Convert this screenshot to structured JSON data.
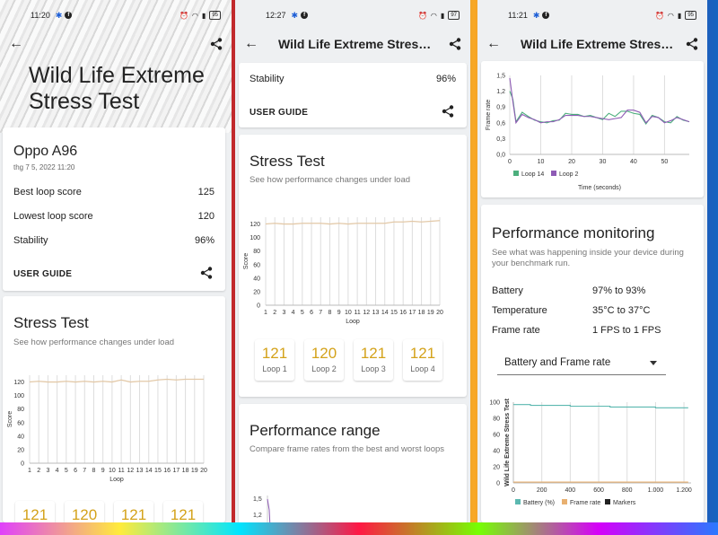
{
  "colors": {
    "accent_gold": "#d4a21a",
    "line_green": "#4caf7d",
    "line_purple": "#8e5bb5",
    "battery_teal": "#5bb8b0",
    "framerate_orange": "#e8b070",
    "markers_black": "#222222",
    "score_line": "#e3c9a8"
  },
  "phone1": {
    "time": "11:20",
    "battery": "95",
    "title_line1": "Wild Life Extreme",
    "title_line2": "Stress Test",
    "device_name": "Oppo A96",
    "device_date": "thg 7 5, 2022 11:20",
    "rows": [
      {
        "label": "Best loop score",
        "value": "125"
      },
      {
        "label": "Lowest loop score",
        "value": "120"
      },
      {
        "label": "Stability",
        "value": "96%"
      }
    ],
    "user_guide": "USER GUIDE",
    "stress_title": "Stress Test",
    "stress_sub": "See how performance changes under load",
    "loops": [
      {
        "score": "121"
      },
      {
        "score": "120"
      },
      {
        "score": "121"
      },
      {
        "score": "121"
      }
    ]
  },
  "phone2": {
    "time": "12:27",
    "battery": "97",
    "appbar_title": "Wild Life Extreme Stress...",
    "stability_label": "Stability",
    "stability_value": "96%",
    "user_guide": "USER GUIDE",
    "stress_title": "Stress Test",
    "stress_sub": "See how performance changes under load",
    "loops": [
      {
        "score": "121",
        "label": "Loop 1"
      },
      {
        "score": "120",
        "label": "Loop 2"
      },
      {
        "score": "121",
        "label": "Loop 3"
      },
      {
        "score": "121",
        "label": "Loop 4"
      }
    ],
    "perf_title": "Performance range",
    "perf_sub": "Compare frame rates from the best and worst loops",
    "perf_ticks": [
      "1,5",
      "1,2"
    ]
  },
  "phone3": {
    "time": "11:21",
    "battery": "95",
    "appbar_title": "Wild Life Extreme Stress...",
    "pm_title": "Performance monitoring",
    "pm_sub": "See what was happening inside your device during your benchmark run.",
    "pm_rows": [
      {
        "label": "Battery",
        "value": "97% to 93%"
      },
      {
        "label": "Temperature",
        "value": "35°C to 37°C"
      },
      {
        "label": "Frame rate",
        "value": "1 FPS to 1 FPS"
      }
    ],
    "dropdown_value": "Battery and Frame rate"
  },
  "chart_data": [
    {
      "type": "line",
      "id": "stress_test_phone1",
      "xlabel": "Loop",
      "ylabel": "Score",
      "x": [
        1,
        2,
        3,
        4,
        5,
        6,
        7,
        8,
        9,
        10,
        11,
        12,
        13,
        14,
        15,
        16,
        17,
        18,
        19,
        20
      ],
      "values": [
        120,
        121,
        120,
        120,
        121,
        120,
        121,
        120,
        121,
        120,
        123,
        120,
        121,
        121,
        123,
        124,
        123,
        124,
        124,
        124
      ],
      "yticks": [
        0,
        20,
        40,
        60,
        80,
        100,
        120
      ],
      "ylim": [
        0,
        130
      ]
    },
    {
      "type": "line",
      "id": "stress_test_phone2",
      "xlabel": "Loop",
      "ylabel": "Score",
      "x": [
        1,
        2,
        3,
        4,
        5,
        6,
        7,
        8,
        9,
        10,
        11,
        12,
        13,
        14,
        15,
        16,
        17,
        18,
        19,
        20
      ],
      "values": [
        120,
        121,
        120,
        120,
        121,
        121,
        121,
        120,
        121,
        120,
        121,
        121,
        121,
        121,
        123,
        123,
        124,
        123,
        124,
        125
      ],
      "yticks": [
        0,
        20,
        40,
        60,
        80,
        100,
        120
      ],
      "ylim": [
        0,
        130
      ]
    },
    {
      "type": "line",
      "id": "frame_rate_loops",
      "xlabel": "Time (seconds)",
      "ylabel": "Frame rate",
      "yticks": [
        "0,0",
        "0,3",
        "0,6",
        "0,9",
        "1,2",
        "1,5"
      ],
      "xticks": [
        "0",
        "10",
        "20",
        "30",
        "40",
        "50"
      ],
      "ylim": [
        0,
        1.5
      ],
      "xlim": [
        0,
        58
      ],
      "series": [
        {
          "name": "Loop 14",
          "x": [
            0,
            1,
            2,
            4,
            6,
            8,
            10,
            12,
            14,
            16,
            18,
            20,
            22,
            24,
            26,
            28,
            30,
            32,
            34,
            36,
            38,
            40,
            42,
            44,
            46,
            48,
            50,
            52,
            54,
            56,
            58
          ],
          "values": [
            1.2,
            1.05,
            0.62,
            0.8,
            0.72,
            0.65,
            0.62,
            0.6,
            0.64,
            0.65,
            0.78,
            0.76,
            0.76,
            0.72,
            0.74,
            0.7,
            0.66,
            0.78,
            0.72,
            0.82,
            0.82,
            0.78,
            0.76,
            0.58,
            0.74,
            0.7,
            0.62,
            0.6,
            0.72,
            0.65,
            0.62
          ]
        },
        {
          "name": "Loop 2",
          "x": [
            0,
            1,
            2,
            4,
            6,
            8,
            10,
            12,
            14,
            16,
            18,
            20,
            22,
            24,
            26,
            28,
            30,
            32,
            34,
            36,
            38,
            40,
            42,
            44,
            46,
            48,
            50,
            52,
            54,
            56,
            58
          ],
          "values": [
            1.45,
            1.0,
            0.6,
            0.76,
            0.7,
            0.66,
            0.6,
            0.62,
            0.62,
            0.66,
            0.74,
            0.74,
            0.74,
            0.72,
            0.72,
            0.7,
            0.68,
            0.66,
            0.68,
            0.7,
            0.84,
            0.84,
            0.8,
            0.6,
            0.72,
            0.7,
            0.6,
            0.64,
            0.7,
            0.66,
            0.62
          ]
        }
      ]
    },
    {
      "type": "line",
      "id": "battery_frame_rate",
      "ylabel": "Wild Life Extreme Stress Test",
      "yticks": [
        "0",
        "20",
        "40",
        "60",
        "80",
        "100"
      ],
      "xticks": [
        "0",
        "200",
        "400",
        "600",
        "800",
        "1.000",
        "1.200"
      ],
      "ylim": [
        0,
        100
      ],
      "xlim": [
        0,
        1250
      ],
      "series": [
        {
          "name": "Battery (%)",
          "x": [
            0,
            120,
            120,
            400,
            400,
            680,
            680,
            1000,
            1000,
            1230
          ],
          "values": [
            97,
            97,
            96,
            96,
            95,
            95,
            94,
            94,
            93,
            93
          ]
        },
        {
          "name": "Frame rate",
          "x": [
            0,
            1230
          ],
          "values": [
            1,
            1
          ]
        },
        {
          "name": "Markers",
          "x": [],
          "values": []
        }
      ]
    }
  ]
}
